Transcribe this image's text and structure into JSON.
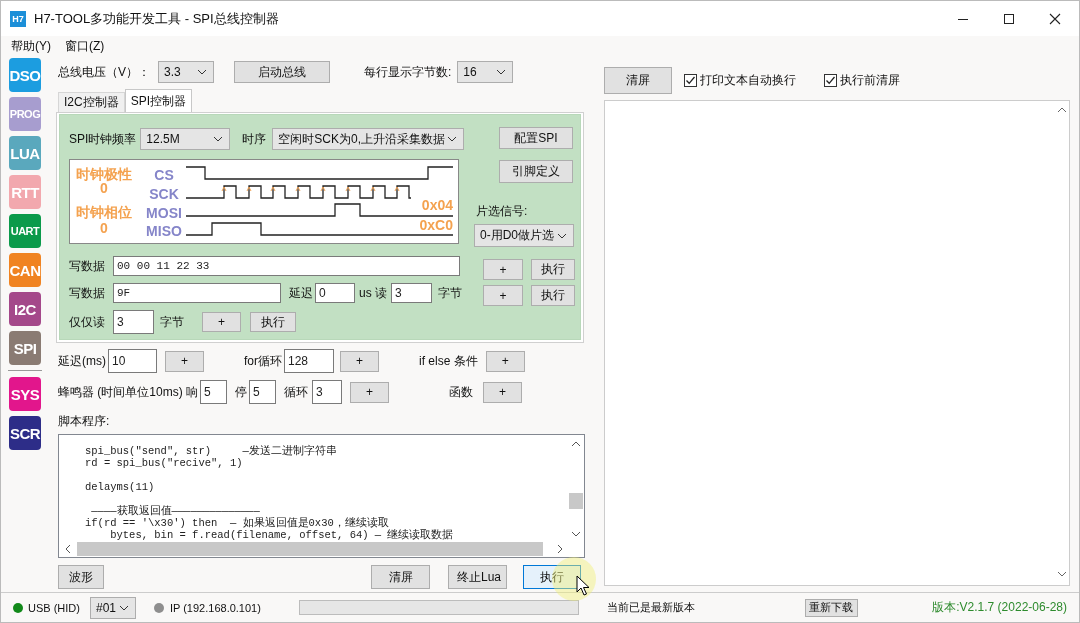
{
  "window": {
    "title": "H7-TOOL多功能开发工具 - SPI总线控制器",
    "icon_text": "H7"
  },
  "menu": [
    {
      "label": "帮助(Y)"
    },
    {
      "label": "窗口(Z)"
    }
  ],
  "sidebar": [
    {
      "label": "DSO",
      "color": "#1c9de0"
    },
    {
      "label": "PROG",
      "color": "#a79dcf"
    },
    {
      "label": "LUA",
      "color": "#5aa8bd"
    },
    {
      "label": "RTT",
      "color": "#f2a8ae"
    },
    {
      "label": "UART",
      "color": "#0b9a4b"
    },
    {
      "label": "CAN",
      "color": "#f08321"
    },
    {
      "label": "I2C",
      "color": "#a4488a"
    },
    {
      "label": "SPI",
      "color": "#8a7b73"
    }
  ],
  "sidebar_system": [
    {
      "label": "SYS",
      "color": "#e2168c"
    },
    {
      "label": "SCR",
      "color": "#2d2d88"
    }
  ],
  "bus": {
    "voltage_label": "总线电压（V）：",
    "voltage": "3.3",
    "start_button": "启动总线",
    "bytes_per_line_label": "每行显示字节数:",
    "bytes_per_line": "16"
  },
  "tabs": [
    {
      "label": "I2C控制器",
      "selected": false
    },
    {
      "label": "SPI控制器",
      "selected": true
    }
  ],
  "spi": {
    "clock_label": "SPI时钟频率",
    "clock": "12.5M",
    "timing_label": "时序",
    "timing": "空闲时SCK为0,上升沿采集数据",
    "config_button": "配置SPI",
    "pins_button": "引脚定义",
    "cs_label": "片选信号:",
    "cs": "0-用D0做片选",
    "diagram": {
      "polarity_label": "时钟极性",
      "polarity": "0",
      "phase_label": "时钟相位",
      "phase": "0",
      "signals": [
        "CS",
        "SCK",
        "MOSI",
        "MISO"
      ],
      "mosi_value": "0x04",
      "miso_value": "0xC0"
    },
    "write_rows": [
      {
        "label": "写数据",
        "value": "00 00 11 22 33",
        "add": "+",
        "run": "执行"
      },
      {
        "label": "写数据",
        "value": "9F",
        "delay_label": "延迟",
        "delay": "0",
        "read_label": "us 读",
        "read": "3",
        "unit": "字节",
        "add": "+",
        "run": "执行"
      }
    ],
    "read_row": {
      "label": "仅仅读",
      "value": "3",
      "unit": "字节",
      "add": "+",
      "run": "执行"
    }
  },
  "insert": {
    "delay_label": "延迟(ms)",
    "delay": "10",
    "delay_add": "+",
    "for_label": "for循环",
    "for": "128",
    "for_add": "+",
    "if_label": "if else 条件",
    "if_add": "+",
    "beep_label": "蜂鸣器 (时间单位10ms) 响",
    "beep_on": "5",
    "stop_label": "停",
    "beep_off": "5",
    "loop_label": "循环",
    "loop": "3",
    "beep_add": "+",
    "func_label": "函数",
    "func_add": "+"
  },
  "script": {
    "label": "脚本程序:",
    "code": "spi_bus(\"send\", str)     —发送二进制字符串\nrd = spi_bus(\"recive\", 1)\n\ndelayms(11)\n\n ————获取返回值——————————————\nif(rd == '\\x30') then  — 如果返回值是0x30，继续读取\n    bytes, bin = f.read(filename, offset, 64) — 继续读取数据"
  },
  "script_buttons": [
    {
      "label": "波形",
      "hovered": false
    },
    {
      "label": "清屏",
      "hovered": false
    },
    {
      "label": "终止Lua",
      "hovered": false
    },
    {
      "label": "执行",
      "hovered": true
    }
  ],
  "output": {
    "clear_button": "清屏",
    "options": [
      {
        "label": "打印文本自动换行",
        "checked": true
      },
      {
        "label": "执行前清屏",
        "checked": true
      }
    ]
  },
  "status_bar": {
    "connection": {
      "label": "USB (HID)",
      "color": "#12891a"
    },
    "device": "#01",
    "network": {
      "label": "IP (192.168.0.101)",
      "color": "#8e8e8e"
    },
    "progress": {
      "level": 0
    },
    "message": "当前已是最新版本",
    "redownload_button": "重新下载",
    "version": "版本:V2.1.7 (2022-06-28)"
  }
}
